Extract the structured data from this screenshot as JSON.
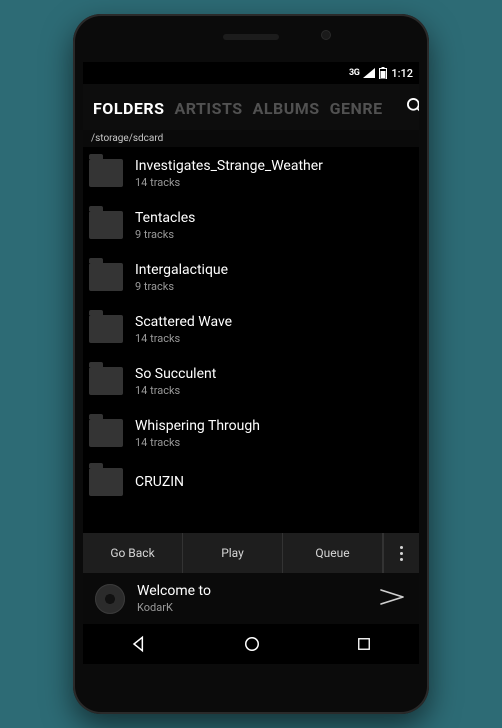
{
  "status": {
    "network": "3G",
    "time": "1:12"
  },
  "tabs": {
    "items": [
      {
        "label": "FOLDERS",
        "active": true
      },
      {
        "label": "ARTISTS",
        "active": false
      },
      {
        "label": "ALBUMS",
        "active": false
      },
      {
        "label": "GENRE",
        "active": false
      }
    ]
  },
  "breadcrumb": "/storage/sdcard",
  "folders": [
    {
      "name": "Investigates_Strange_Weather",
      "tracks": "14 tracks"
    },
    {
      "name": "Tentacles",
      "tracks": "9 tracks"
    },
    {
      "name": "Intergalactique",
      "tracks": "9 tracks"
    },
    {
      "name": "Scattered Wave",
      "tracks": "14 tracks"
    },
    {
      "name": "So Succulent",
      "tracks": "14 tracks"
    },
    {
      "name": "Whispering Through",
      "tracks": "14 tracks"
    },
    {
      "name": "CRUZIN",
      "tracks": ""
    }
  ],
  "actions": {
    "back": "Go Back",
    "play": "Play",
    "queue": "Queue"
  },
  "now_playing": {
    "title": "Welcome to",
    "artist": "KodarK"
  }
}
